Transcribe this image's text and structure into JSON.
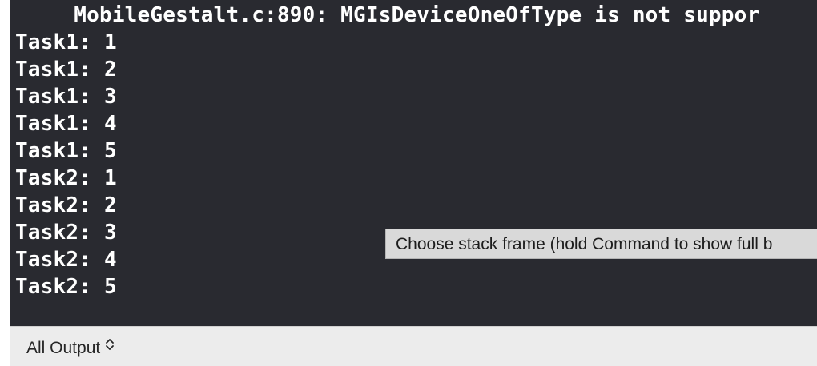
{
  "console": {
    "header": "     MobileGestalt.c:890: MGIsDeviceOneOfType is not suppor",
    "lines": [
      "Task1: 1",
      "Task1: 2",
      "Task1: 3",
      "Task1: 4",
      "Task1: 5",
      "Task2: 1",
      "Task2: 2",
      "Task2: 3",
      "Task2: 4",
      "Task2: 5"
    ]
  },
  "tooltip": {
    "text": "Choose stack frame (hold Command to show full b"
  },
  "bottom_bar": {
    "scope_label": "All Output",
    "scope_icon": "up-down-chevron-icon"
  },
  "colors": {
    "console_background": "#292a30",
    "console_text": "#ffffff",
    "tooltip_background": "#d9d9d9"
  }
}
